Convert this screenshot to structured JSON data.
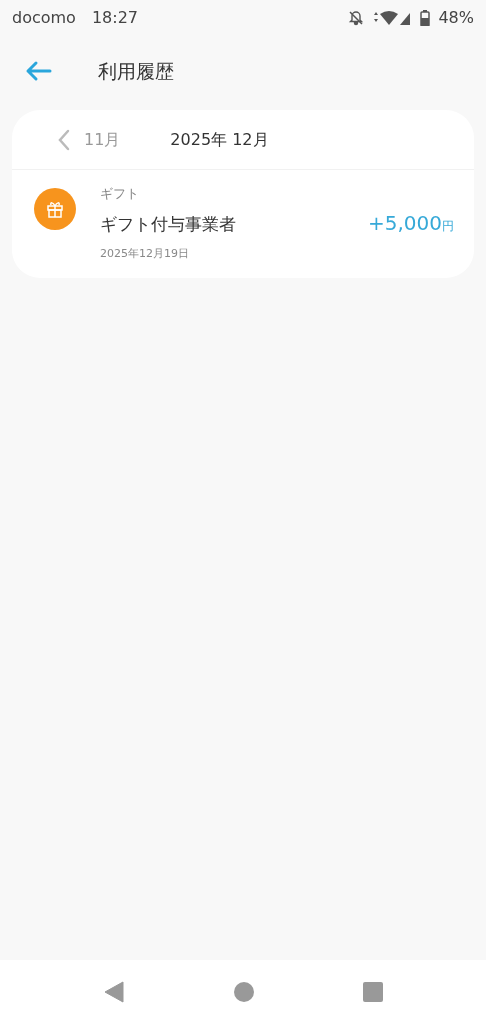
{
  "status_bar": {
    "carrier": "docomo",
    "time": "18:27",
    "battery": "48%"
  },
  "header": {
    "title": "利用履歴"
  },
  "month_nav": {
    "previous": "11月",
    "current": "2025年 12月"
  },
  "transactions": [
    {
      "kind": "gift",
      "category": "ギフト",
      "name": "ギフト付与事業者",
      "amount": "+5,000",
      "currency": "円",
      "date": "2025年12月19日"
    }
  ]
}
